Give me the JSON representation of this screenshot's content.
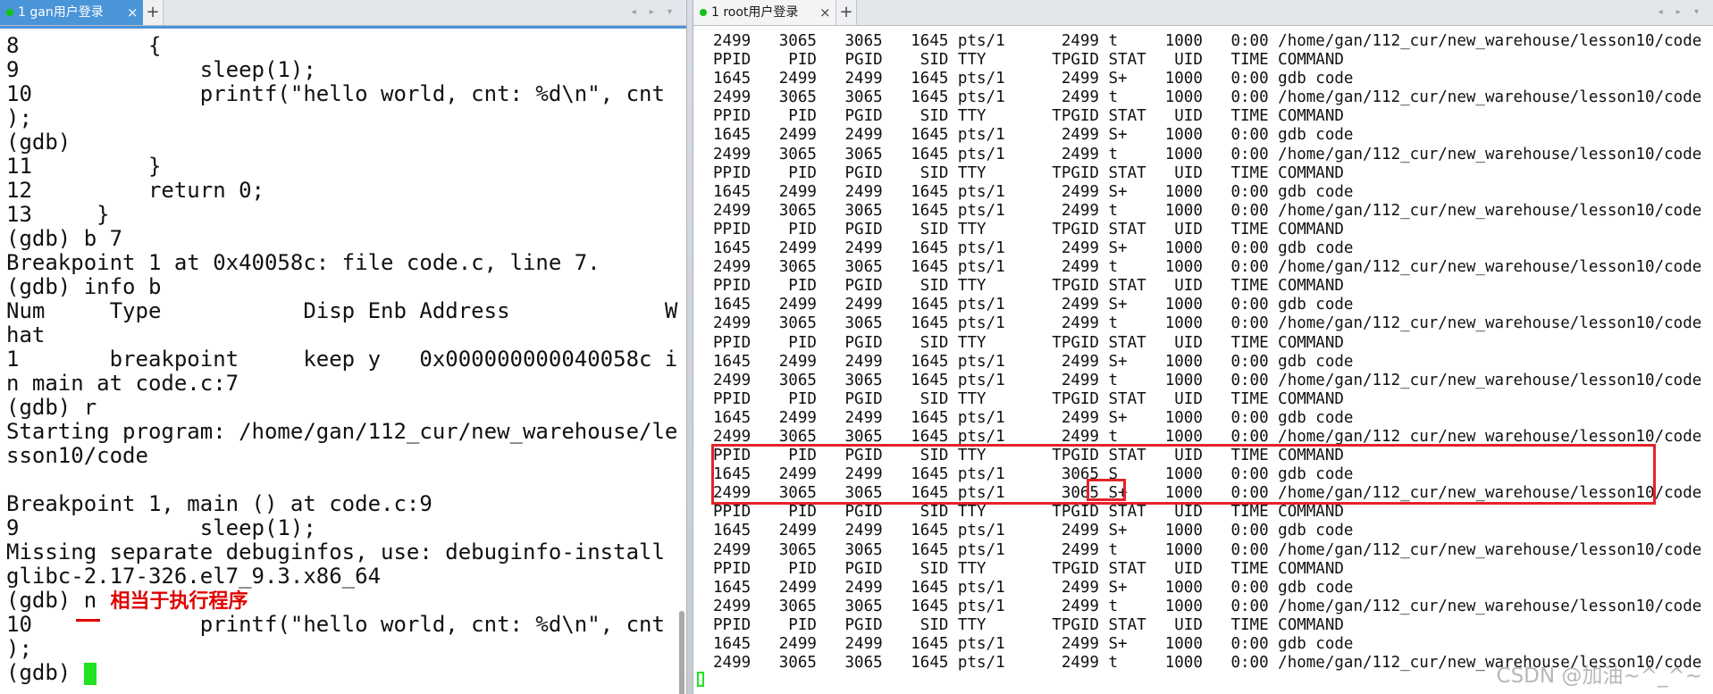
{
  "left_tab": {
    "label": "1 gan用户登录",
    "close": "×",
    "add": "+"
  },
  "right_tab": {
    "label": "1 root用户登录",
    "close": "×",
    "add": "+"
  },
  "tab_arrows": "◂ ▸ ▾",
  "left_terminal": {
    "lines": [
      "8          {",
      "9              sleep(1);",
      "10             printf(\"hello world, cnt: %d\\n\", cnt",
      ");",
      "(gdb)",
      "11         }",
      "12         return 0;",
      "13     }",
      "(gdb) b 7",
      "Breakpoint 1 at 0x40058c: file code.c, line 7.",
      "(gdb) info b",
      "Num     Type           Disp Enb Address            W",
      "hat",
      "1       breakpoint     keep y   0x000000000040058c i",
      "n main at code.c:7",
      "(gdb) r",
      "Starting program: /home/gan/112_cur/new_warehouse/le",
      "sson10/code",
      "",
      "Breakpoint 1, main () at code.c:9",
      "9              sleep(1);",
      "Missing separate debuginfos, use: debuginfo-install",
      "glibc-2.17-326.el7_9.3.x86_64"
    ],
    "cmd_prompt": "(gdb) ",
    "cmd_text": "n",
    "annotation": "相当于执行程序",
    "after_lines": [
      "10             printf(\"hello world, cnt: %d\\n\", cnt",
      ");"
    ],
    "final_prompt": "(gdb) "
  },
  "right_terminal": {
    "lines": [
      "2499   3065   3065   1645 pts/1      2499 t     1000   0:00 /home/gan/112_cur/new_warehouse/lesson10/code",
      "PPID    PID   PGID    SID TTY       TPGID STAT   UID   TIME COMMAND",
      "1645   2499   2499   1645 pts/1      2499 S+    1000   0:00 gdb code",
      "2499   3065   3065   1645 pts/1      2499 t     1000   0:00 /home/gan/112_cur/new_warehouse/lesson10/code",
      "PPID    PID   PGID    SID TTY       TPGID STAT   UID   TIME COMMAND",
      "1645   2499   2499   1645 pts/1      2499 S+    1000   0:00 gdb code",
      "2499   3065   3065   1645 pts/1      2499 t     1000   0:00 /home/gan/112_cur/new_warehouse/lesson10/code",
      "PPID    PID   PGID    SID TTY       TPGID STAT   UID   TIME COMMAND",
      "1645   2499   2499   1645 pts/1      2499 S+    1000   0:00 gdb code",
      "2499   3065   3065   1645 pts/1      2499 t     1000   0:00 /home/gan/112_cur/new_warehouse/lesson10/code",
      "PPID    PID   PGID    SID TTY       TPGID STAT   UID   TIME COMMAND",
      "1645   2499   2499   1645 pts/1      2499 S+    1000   0:00 gdb code",
      "2499   3065   3065   1645 pts/1      2499 t     1000   0:00 /home/gan/112_cur/new_warehouse/lesson10/code",
      "PPID    PID   PGID    SID TTY       TPGID STAT   UID   TIME COMMAND",
      "1645   2499   2499   1645 pts/1      2499 S+    1000   0:00 gdb code",
      "2499   3065   3065   1645 pts/1      2499 t     1000   0:00 /home/gan/112_cur/new_warehouse/lesson10/code",
      "PPID    PID   PGID    SID TTY       TPGID STAT   UID   TIME COMMAND",
      "1645   2499   2499   1645 pts/1      2499 S+    1000   0:00 gdb code",
      "2499   3065   3065   1645 pts/1      2499 t     1000   0:00 /home/gan/112_cur/new_warehouse/lesson10/code",
      "PPID    PID   PGID    SID TTY       TPGID STAT   UID   TIME COMMAND",
      "1645   2499   2499   1645 pts/1      2499 S+    1000   0:00 gdb code",
      "2499   3065   3065   1645 pts/1      2499 t     1000   0:00 /home/gan/112_cur/new_warehouse/lesson10/code",
      "PPID    PID   PGID    SID TTY       TPGID STAT   UID   TIME COMMAND",
      "1645   2499   2499   1645 pts/1      3065 S     1000   0:00 gdb code",
      "2499   3065   3065   1645 pts/1      3065 S+    1000   0:00 /home/gan/112_cur/new_warehouse/lesson10/code",
      "PPID    PID   PGID    SID TTY       TPGID STAT   UID   TIME COMMAND",
      "1645   2499   2499   1645 pts/1      2499 S+    1000   0:00 gdb code",
      "2499   3065   3065   1645 pts/1      2499 t     1000   0:00 /home/gan/112_cur/new_warehouse/lesson10/code",
      "PPID    PID   PGID    SID TTY       TPGID STAT   UID   TIME COMMAND",
      "1645   2499   2499   1645 pts/1      2499 S+    1000   0:00 gdb code",
      "2499   3065   3065   1645 pts/1      2499 t     1000   0:00 /home/gan/112_cur/new_warehouse/lesson10/code",
      "PPID    PID   PGID    SID TTY       TPGID STAT   UID   TIME COMMAND",
      "1645   2499   2499   1645 pts/1      2499 S+    1000   0:00 gdb code",
      "2499   3065   3065   1645 pts/1      2499 t     1000   0:00 /home/gan/112_cur/new_warehouse/lesson10/code"
    ],
    "highlight_rows": [
      22,
      24
    ],
    "highlight_stat_row": 24
  },
  "watermark": "CSDN @加油~^_^~",
  "colors": {
    "accent": "#4a94d8",
    "highlight": "#e3232a",
    "cursor": "#21e321",
    "annotation": "#e00000"
  }
}
